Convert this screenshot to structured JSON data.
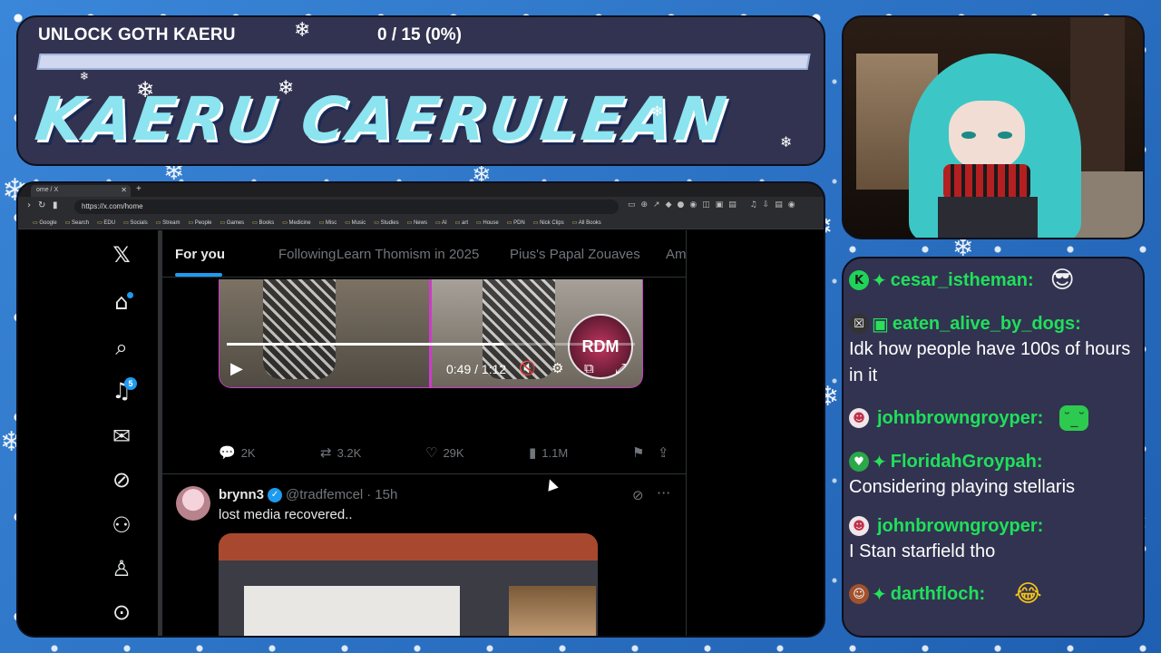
{
  "overlay": {
    "goal_label": "UNLOCK GOTH KAERU",
    "goal_count": "0 / 15 (0%)",
    "goal_progress": 0,
    "title": "KAERU CAERULEAN"
  },
  "chat": {
    "messages": [
      {
        "user": "cesar_istheman",
        "text": "",
        "badge": "K",
        "badge_color": "#1fd35a",
        "emote": "sunglasses-wojak"
      },
      {
        "user": "eaten_alive_by_dogs",
        "text": "Idk how people have 100s of hours in it",
        "badge": "☒",
        "badge_color": "#333333",
        "emote": ""
      },
      {
        "user": "johnbrowngroyper",
        "text": "",
        "badge": "☻",
        "badge_color": "#f0e6ea",
        "emote": "green-pepe"
      },
      {
        "user": "FloridahGroypah",
        "text": "Considering playing stellaris",
        "badge": "♥",
        "badge_color": "#2aa84a",
        "emote": ""
      },
      {
        "user": "johnbrowngroyper",
        "text": "I Stan starfield tho",
        "badge": "☻",
        "badge_color": "#f0e6ea",
        "emote": ""
      },
      {
        "user": "darthfloch",
        "text": "",
        "badge": "☺",
        "badge_color": "#a0522d",
        "emote": "crying-laughing"
      }
    ],
    "colon": ":"
  },
  "browser": {
    "tab_title": "ome / X",
    "url": "https://x.com/home",
    "bookmarks": [
      "Google",
      "Search",
      "EDU",
      "Socials",
      "Stream",
      "People",
      "Games",
      "Books",
      "Medicine",
      "Misc",
      "Music",
      "Studies",
      "News",
      "AI",
      "art",
      "House",
      "PDN",
      "Nick Clips",
      "All Books"
    ]
  },
  "x": {
    "notifications_count": "5",
    "tabs": [
      "For you",
      "Following",
      "Learn Thomism in 2025",
      "Pius's Papal Zouaves",
      "Am"
    ],
    "video": {
      "time": "0:49 / 1:12",
      "progress": 0.68,
      "logo": "RDM"
    },
    "actions": {
      "replies": "2K",
      "reposts": "3.2K",
      "likes": "29K",
      "views": "1.1M"
    },
    "tweet": {
      "name": "brynn3",
      "handle": "@tradfemcel",
      "dot": "·",
      "time": "15h",
      "text": "lost media recovered.."
    }
  },
  "colors": {
    "accent": "#1d9bf0",
    "chat_user": "#1fe05a",
    "panel": "#323350",
    "title": "#8be4ef"
  }
}
